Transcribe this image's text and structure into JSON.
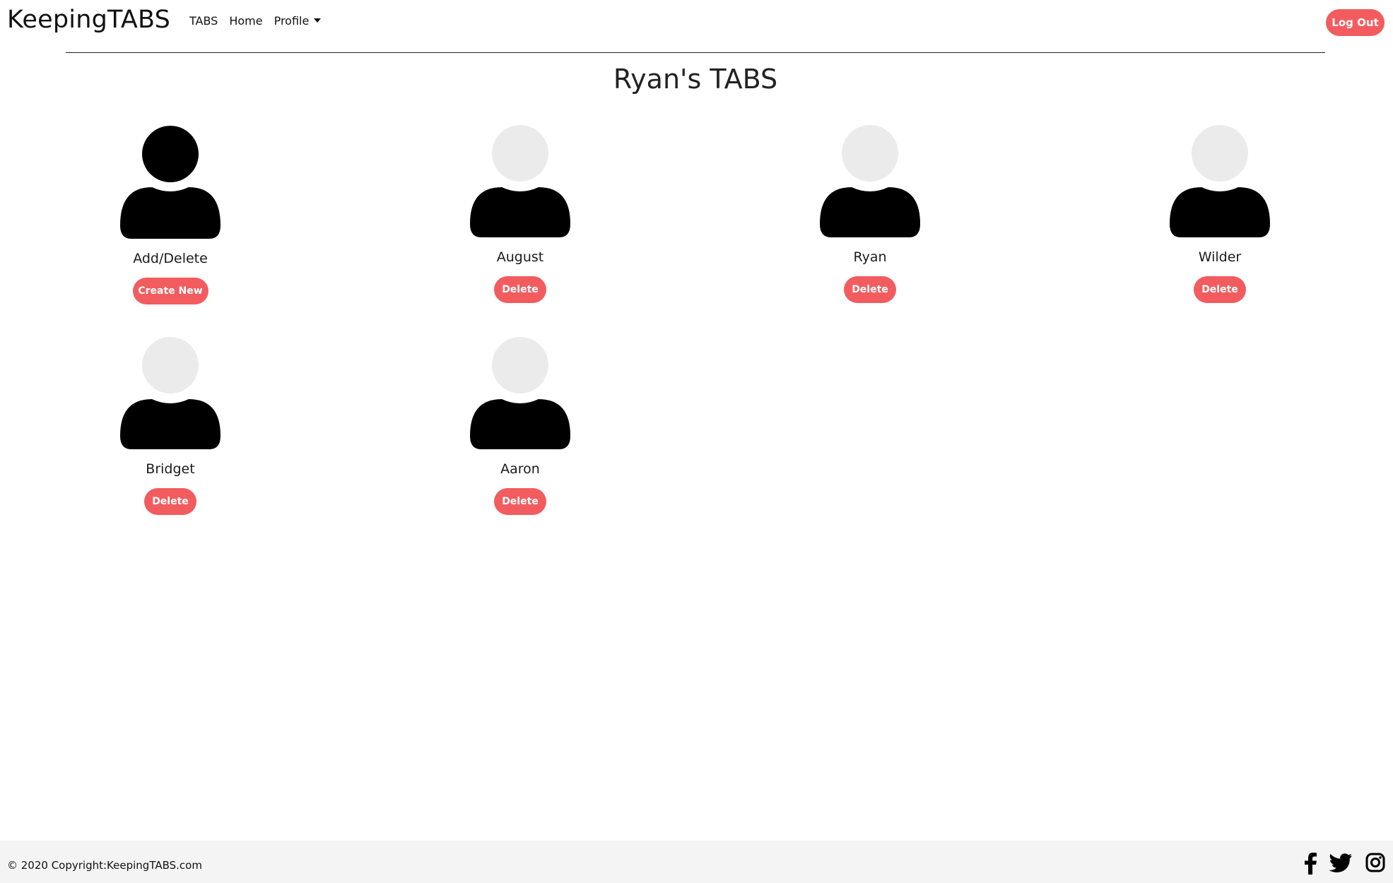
{
  "navbar": {
    "brand": "KeepingTABS",
    "links": [
      {
        "label": "TABS"
      },
      {
        "label": "Home"
      },
      {
        "label": "Profile"
      }
    ],
    "logout_label": "Log Out"
  },
  "page_title": "Ryan's TABS",
  "cards": [
    {
      "name": "Add/Delete",
      "button": "Create New"
    },
    {
      "name": "August",
      "button": "Delete"
    },
    {
      "name": "Ryan",
      "button": "Delete"
    },
    {
      "name": "Wilder",
      "button": "Delete"
    },
    {
      "name": "Bridget",
      "button": "Delete"
    },
    {
      "name": "Aaron",
      "button": "Delete"
    }
  ],
  "footer": {
    "copyright": "© 2020 Copyright:KeepingTABS.com",
    "social_icons": [
      "facebook-icon",
      "twitter-icon",
      "instagram-icon"
    ]
  },
  "colors": {
    "accent": "#f25c5f",
    "avatar_head_placeholder": "#ebebeb",
    "avatar_body": "#000000"
  }
}
